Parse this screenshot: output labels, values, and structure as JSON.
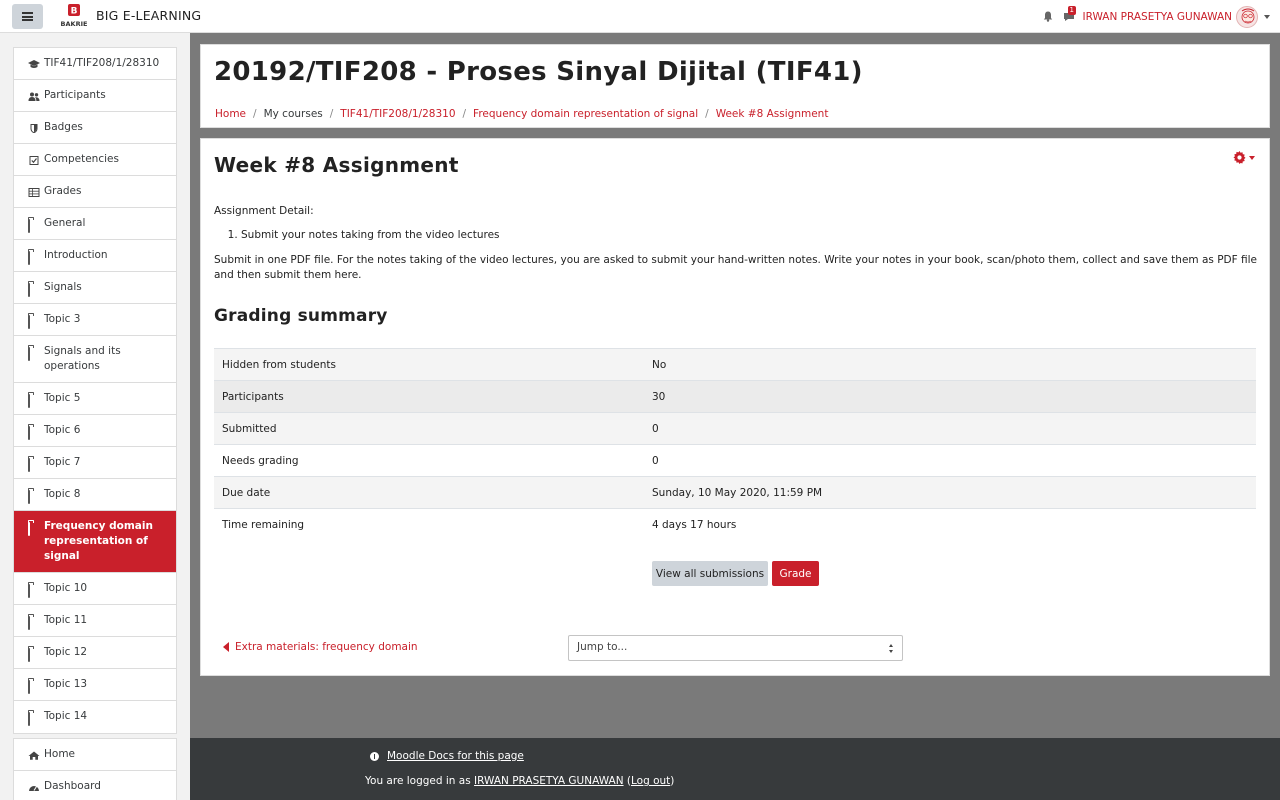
{
  "navbar": {
    "site_name": "BIG E-LEARNING",
    "user_name": "IRWAN PRASETYA GUNAWAN",
    "message_count": "1"
  },
  "sidebar": {
    "items": [
      {
        "label": "TIF41/TIF208/1/28310",
        "icon": "graduation-cap-icon"
      },
      {
        "label": "Participants",
        "icon": "users-icon"
      },
      {
        "label": "Badges",
        "icon": "shield-icon"
      },
      {
        "label": "Competencies",
        "icon": "check-square-icon"
      },
      {
        "label": "Grades",
        "icon": "table-icon"
      },
      {
        "label": "General",
        "icon": "folder-icon"
      },
      {
        "label": "Introduction",
        "icon": "folder-icon"
      },
      {
        "label": "Signals",
        "icon": "folder-icon"
      },
      {
        "label": "Topic 3",
        "icon": "folder-icon"
      },
      {
        "label": "Signals and its operations",
        "icon": "folder-icon"
      },
      {
        "label": "Topic 5",
        "icon": "folder-icon"
      },
      {
        "label": "Topic 6",
        "icon": "folder-icon"
      },
      {
        "label": "Topic 7",
        "icon": "folder-icon"
      },
      {
        "label": "Topic 8",
        "icon": "folder-icon"
      },
      {
        "label": "Frequency domain representation of signal",
        "icon": "folder-icon",
        "active": true
      },
      {
        "label": "Topic 10",
        "icon": "folder-icon"
      },
      {
        "label": "Topic 11",
        "icon": "folder-icon"
      },
      {
        "label": "Topic 12",
        "icon": "folder-icon"
      },
      {
        "label": "Topic 13",
        "icon": "folder-icon"
      },
      {
        "label": "Topic 14",
        "icon": "folder-icon"
      }
    ],
    "bottom_items": [
      {
        "label": "Home",
        "icon": "home-icon"
      },
      {
        "label": "Dashboard",
        "icon": "dashboard-icon"
      }
    ]
  },
  "header": {
    "title": "20192/TIF208 - Proses Sinyal Dijital (TIF41)",
    "breadcrumb": [
      {
        "label": "Home",
        "link": true
      },
      {
        "label": "My courses",
        "link": false
      },
      {
        "label": "TIF41/TIF208/1/28310",
        "link": true
      },
      {
        "label": "Frequency domain representation of signal",
        "link": true
      },
      {
        "label": "Week #8 Assignment",
        "link": true
      }
    ]
  },
  "assignment": {
    "title": "Week #8 Assignment",
    "detail_heading": "Assignment Detail:",
    "detail_item": "Submit your notes taking from the video lectures",
    "description": "Submit in one PDF file. For the notes taking of the video lectures, you are asked to submit your hand-written notes. Write your notes in your book, scan/photo them, collect and save them as PDF file and then submit them here."
  },
  "grading": {
    "title": "Grading summary",
    "rows": [
      {
        "label": "Hidden from students",
        "value": "No"
      },
      {
        "label": "Participants",
        "value": "30"
      },
      {
        "label": "Submitted",
        "value": "0"
      },
      {
        "label": "Needs grading",
        "value": "0"
      },
      {
        "label": "Due date",
        "value": "Sunday, 10 May 2020, 11:59 PM"
      },
      {
        "label": "Time remaining",
        "value": "4 days 17 hours"
      }
    ],
    "view_all_label": "View all submissions",
    "grade_label": "Grade"
  },
  "navigation": {
    "prev_link": "Extra materials: frequency domain",
    "jump_placeholder": "Jump to..."
  },
  "footer": {
    "docs_link": "Moodle Docs for this page",
    "logged_in_prefix": "You are logged in as ",
    "logged_in_user": "IRWAN PRASETYA GUNAWAN",
    "logout_open": " (",
    "logout_label": "Log out",
    "logout_close": ")"
  },
  "colors": {
    "accent": "#c9202b",
    "footer_bg": "#373a3c",
    "page_bg": "#7a7a7a"
  }
}
